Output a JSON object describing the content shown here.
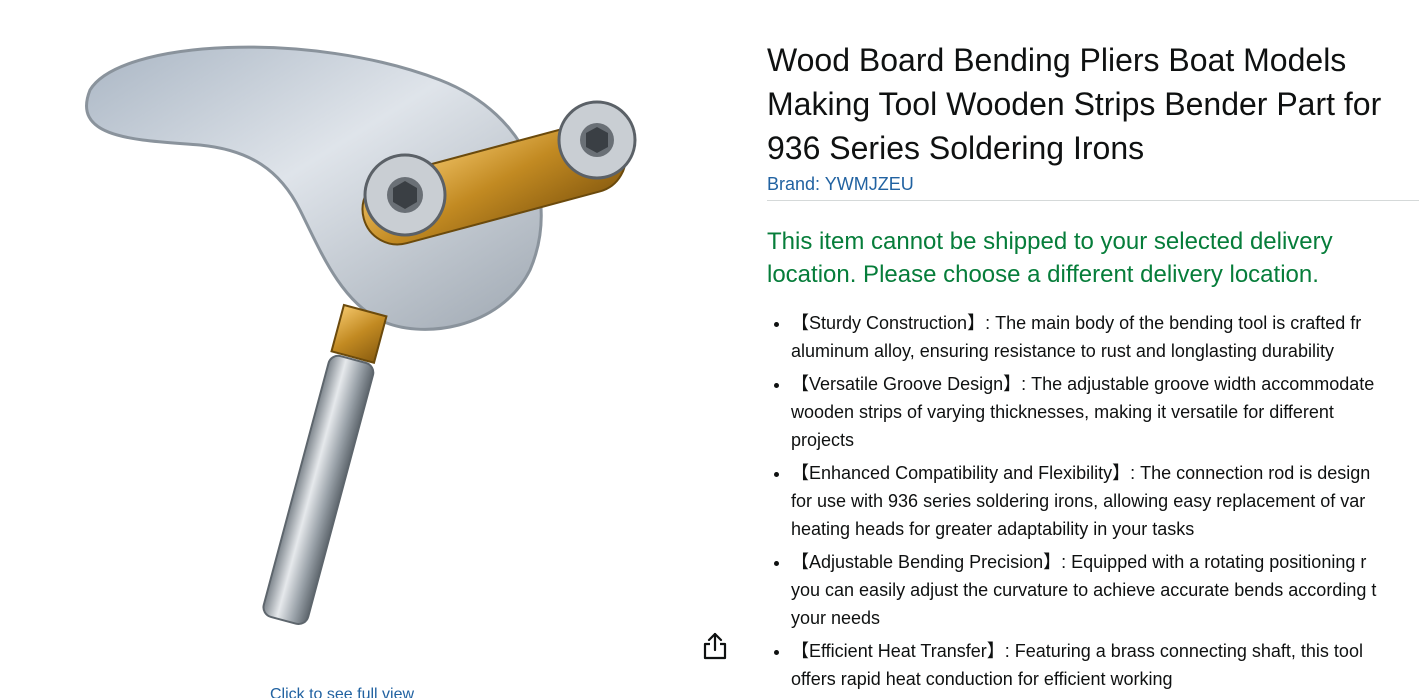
{
  "product": {
    "title_lines": [
      "Wood Board Bending Pliers Boat Models",
      "Making Tool Wooden Strips Bender Part for",
      "936 Series Soldering Irons"
    ],
    "brand": "Brand: YWMJZEU",
    "shipping_message_lines": [
      "This item cannot be shipped to your selected delivery",
      "location. Please choose a different delivery location."
    ],
    "bullets": [
      {
        "lines": [
          "【Sturdy Construction】: The main body of the bending tool is crafted fr",
          "aluminum alloy, ensuring resistance to rust and longlasting durability"
        ]
      },
      {
        "lines": [
          "【Versatile Groove Design】: The adjustable groove width accommodate",
          "wooden strips of varying thicknesses, making it versatile for different",
          "projects"
        ]
      },
      {
        "lines": [
          "【Enhanced Compatibility and Flexibility】: The connection rod is design",
          "for use with 936 series soldering irons, allowing easy replacement of var",
          "heating heads for greater adaptability in your tasks"
        ]
      },
      {
        "lines": [
          "【Adjustable Bending Precision】: Equipped with a rotating positioning r",
          "you can easily adjust the curvature to achieve accurate bends according t",
          "your needs"
        ]
      },
      {
        "lines": [
          "【Efficient Heat Transfer】: Featuring a brass connecting shaft, this tool",
          "offers rapid heat conduction for efficient working"
        ]
      }
    ]
  },
  "image_panel": {
    "fullview_link": "Click to see full view",
    "share_icon": "share-icon"
  },
  "colors": {
    "link": "#2162a1",
    "success": "#067d3a",
    "text": "#0f1111"
  }
}
